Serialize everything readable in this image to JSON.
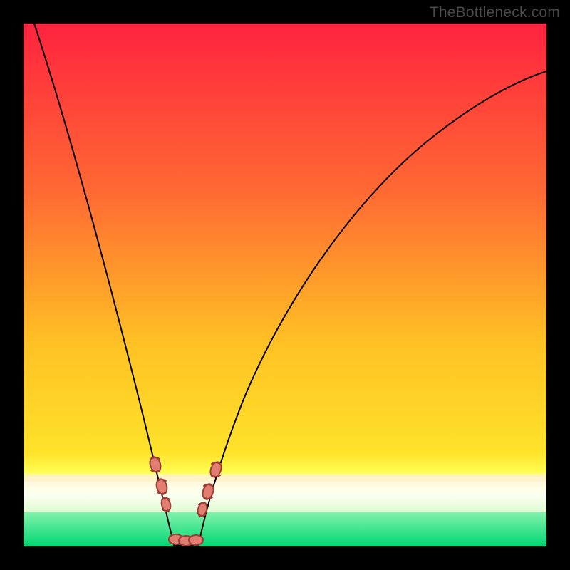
{
  "watermark": "TheBottleneck.com",
  "chart_data": {
    "type": "line",
    "title": "",
    "xlabel": "",
    "ylabel": "",
    "xlim": [
      0,
      100
    ],
    "ylim": [
      0,
      100
    ],
    "grid": false,
    "background_bands": [
      {
        "start": 0.0,
        "end": 82.0,
        "from": "#ff233f",
        "to": "#ffe22a"
      },
      {
        "start": 82.0,
        "end": 86.0,
        "from": "#ffe22a",
        "to": "#ffff55"
      },
      {
        "start": 86.0,
        "end": 86.5,
        "color": "#fff7b0"
      },
      {
        "start": 86.5,
        "end": 87.5,
        "color": "#fff2cc"
      },
      {
        "start": 87.5,
        "end": 88.5,
        "color": "#fff9e0"
      },
      {
        "start": 88.5,
        "end": 90.5,
        "from": "#ffffe8",
        "to": "#faffee"
      },
      {
        "start": 90.5,
        "end": 93.5,
        "from": "#faffee",
        "to": "#dcfcd2"
      },
      {
        "start": 93.5,
        "end": 100.0,
        "from": "#82f2ab",
        "to": "#00d874"
      }
    ],
    "series": [
      {
        "name": "left-curve",
        "x": [
          2,
          5,
          8,
          11,
          14,
          17,
          20,
          22,
          24,
          25,
          26,
          27,
          28
        ],
        "y": [
          100,
          88,
          76,
          64,
          52,
          41,
          30,
          21,
          14,
          10,
          6,
          3,
          0
        ]
      },
      {
        "name": "right-curve",
        "x": [
          33,
          35,
          38,
          42,
          47,
          53,
          60,
          68,
          77,
          86,
          95,
          100
        ],
        "y": [
          0,
          5,
          12,
          22,
          34,
          46,
          56,
          65,
          72,
          78,
          83,
          86
        ]
      }
    ],
    "markers": [
      {
        "series": "left-curve",
        "x": 25.2,
        "y": 9.5
      },
      {
        "series": "left-curve",
        "x": 26.3,
        "y": 5.5
      },
      {
        "series": "left-curve",
        "x": 27.0,
        "y": 3.0
      },
      {
        "series": "right-curve",
        "x": 33.5,
        "y": 2.0
      },
      {
        "series": "right-curve",
        "x": 34.8,
        "y": 5.5
      },
      {
        "series": "right-curve",
        "x": 36.5,
        "y": 10.0
      },
      {
        "series": "flat",
        "x": 28.5,
        "y": 0.5
      },
      {
        "series": "flat",
        "x": 30.3,
        "y": 0.5
      },
      {
        "series": "flat",
        "x": 32.0,
        "y": 0.5
      }
    ],
    "optimum_x_range": [
      27,
      33
    ]
  }
}
